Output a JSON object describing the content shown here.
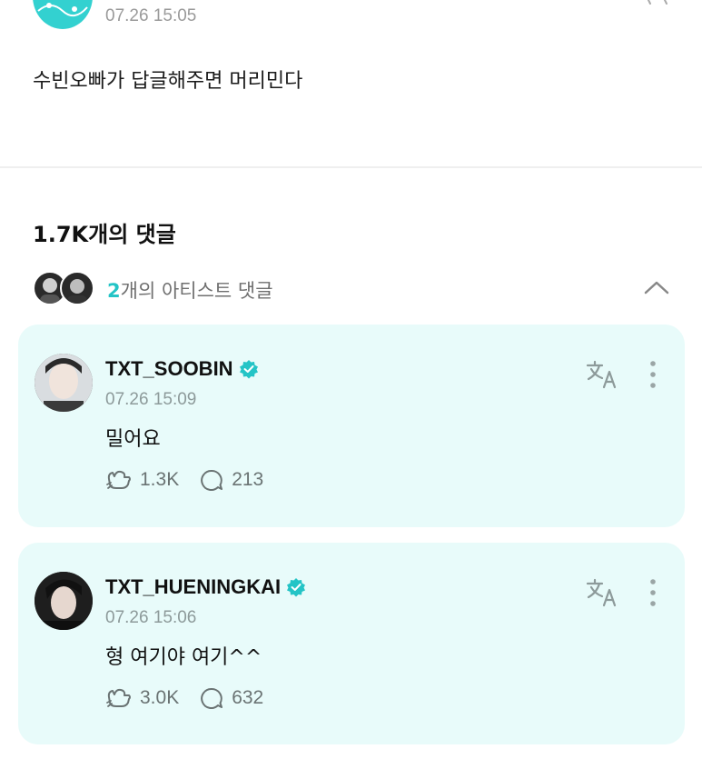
{
  "post": {
    "time": "07.26 15:05",
    "body": "수빈오빠가 답글해주면 머리민다"
  },
  "comments_header": {
    "count_label": "1.7K개의 댓글"
  },
  "artist_row": {
    "count": "2",
    "label": "개의 아티스트 댓글"
  },
  "comments": [
    {
      "author": "TXT_SOOBIN",
      "time": "07.26 15:09",
      "text": "밀어요",
      "likes": "1.3K",
      "replies": "213"
    },
    {
      "author": "TXT_HUENINGKAI",
      "time": "07.26 15:06",
      "text": "형 여기야 여기^^",
      "likes": "3.0K",
      "replies": "632"
    }
  ],
  "colors": {
    "accent": "#24c4c6",
    "card_bg": "#e8fbfa",
    "brand_avatar": "#33d1d0"
  },
  "icons": [
    "logo-avatar",
    "more-dots-icon",
    "chevron-up-icon",
    "verified-icon",
    "translate-icon",
    "like-icon",
    "reply-icon"
  ]
}
